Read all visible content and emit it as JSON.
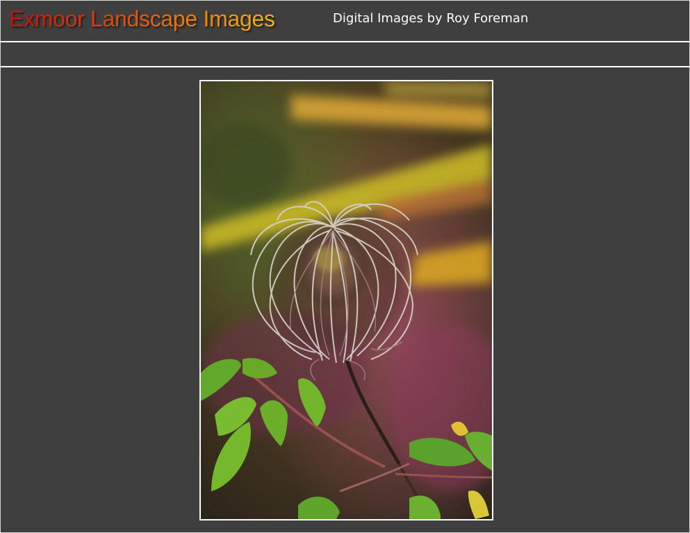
{
  "header": {
    "site_title": "Exmoor Landscape Images",
    "site_subtitle": "Digital Images by Roy Foreman"
  },
  "colors": {
    "background": "#3f3f3f",
    "title_gradient_start": "#c8100c",
    "title_gradient_end": "#f0b418",
    "rule": "#ffffff"
  },
  "main": {
    "photo_icon": "clematis-seedhead-photo"
  }
}
